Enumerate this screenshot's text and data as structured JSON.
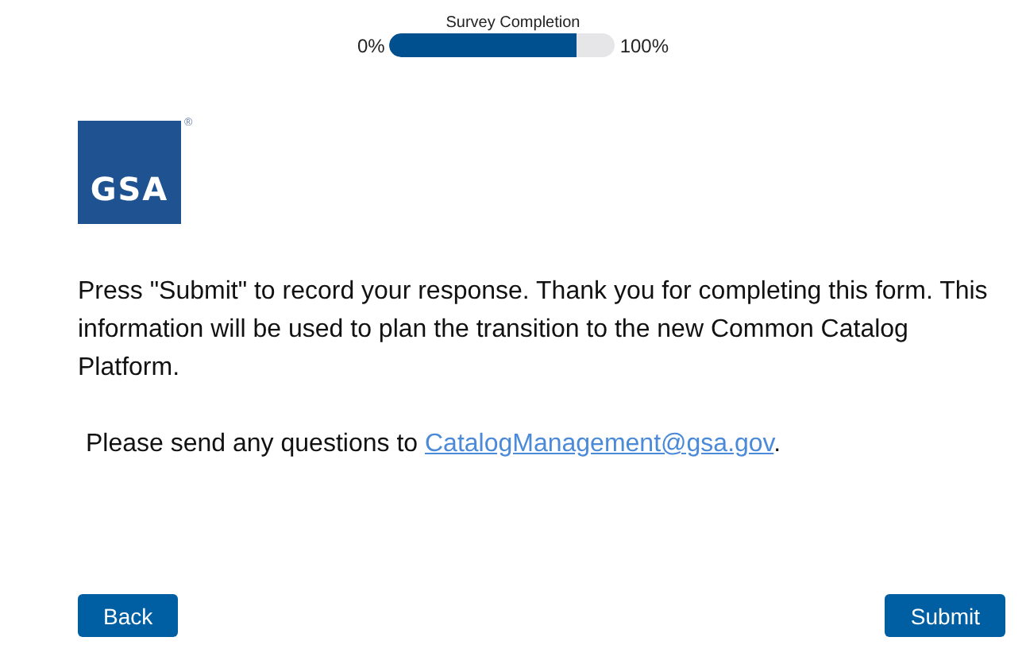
{
  "progress": {
    "title": "Survey Completion",
    "min_label": "0%",
    "max_label": "100%",
    "level": 0.83
  },
  "logo": {
    "text": "GSA",
    "mark": "®"
  },
  "message": "Press \"Submit\" to record your response. Thank you for completing this form. This information will be used to plan the transition to the new Common Catalog Platform.",
  "contact": {
    "text": "Please send any questions to",
    "link": "CatalogManagement@gsa.gov",
    "end": "."
  },
  "buttons": [
    "Back",
    "Submit"
  ]
}
